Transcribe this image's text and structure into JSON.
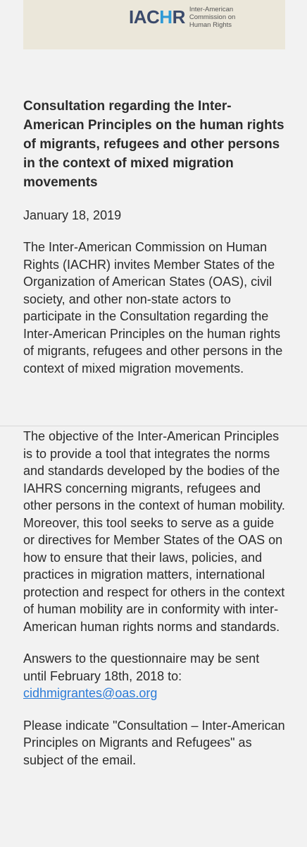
{
  "header": {
    "logo_mark_a": "IAC",
    "logo_mark_h": "H",
    "logo_mark_r": "R",
    "logo_text_lines": [
      "Inter-American",
      "Commission on",
      "Human Rights"
    ]
  },
  "article": {
    "title": "Consultation regarding the Inter-American Principles on the human rights of migrants, refugees and other persons in the context of mixed migration movements",
    "date": "January 18, 2019",
    "paragraph1": "The Inter-American Commission on Human Rights (IACHR) invites Member States of the Organization of American States (OAS), civil society, and other non-state actors to participate in the Consultation regarding the Inter-American Principles on the human rights of migrants, refugees and other persons in the context of mixed migration movements.",
    "paragraph2": "The objective of the Inter-American Principles is to provide a tool that integrates the norms and standards developed by the bodies of the IAHRS concerning migrants, refugees and other persons in the context of human mobility. Moreover, this tool seeks to serve as a guide or directives for Member States of the OAS on how to ensure that their laws, policies, and practices in migration matters, international protection and respect for others in the context of human mobility are in conformity with inter-American human rights norms and standards.",
    "answers_text": "Answers to the questionnaire may be sent until February 18th, 2018 to:",
    "email": "cidhmigrantes@oas.org",
    "paragraph4": "Please indicate \"Consultation – Inter-American Principles on Migrants and Refugees\" as subject of the email."
  }
}
